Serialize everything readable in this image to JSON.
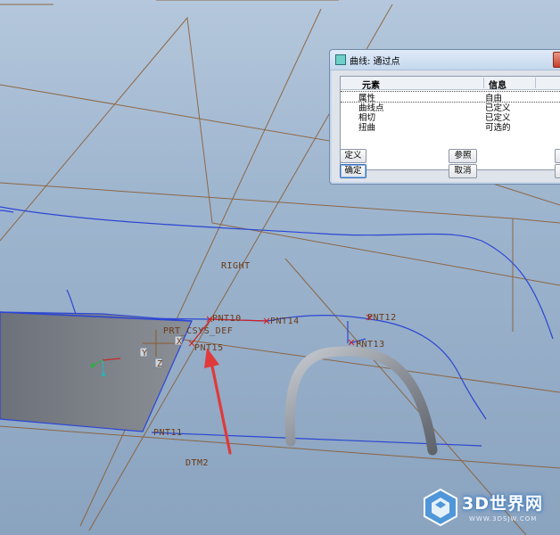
{
  "dialog": {
    "title": "曲线: 通过点",
    "columns": {
      "element": "元素",
      "info": "信息"
    },
    "rows": [
      {
        "element": "属性",
        "info": "自由"
      },
      {
        "element": "曲线点",
        "info": "已定义"
      },
      {
        "element": "相切",
        "info": "已定义"
      },
      {
        "element": "扭曲",
        "info": "可选的"
      }
    ],
    "buttons": {
      "define": "定义",
      "reference": "参照",
      "ok": "确定",
      "cancel": "取消"
    }
  },
  "datum_labels": {
    "right": "RIGHT",
    "pnt10": "PNT10",
    "pnt14": "PNT14",
    "pnt12": "PNT12",
    "pnt13": "PNT13",
    "pnt15": "PNT15",
    "pnt11": "PNT11",
    "csys": "PRT_CSYS_DEF",
    "dtm2": "DTM2",
    "axis_x": "X",
    "axis_y": "Y",
    "axis_z": "Z"
  },
  "watermark": {
    "text": "3D世界网",
    "url": "WWW.3DSJW.COM"
  },
  "colors": {
    "datum_plane": "#8a5a2e",
    "curve": "#2c46d4",
    "sketch_point": "#d02020",
    "arrow": "#e03a3a",
    "part_face": "#7a7e86"
  }
}
